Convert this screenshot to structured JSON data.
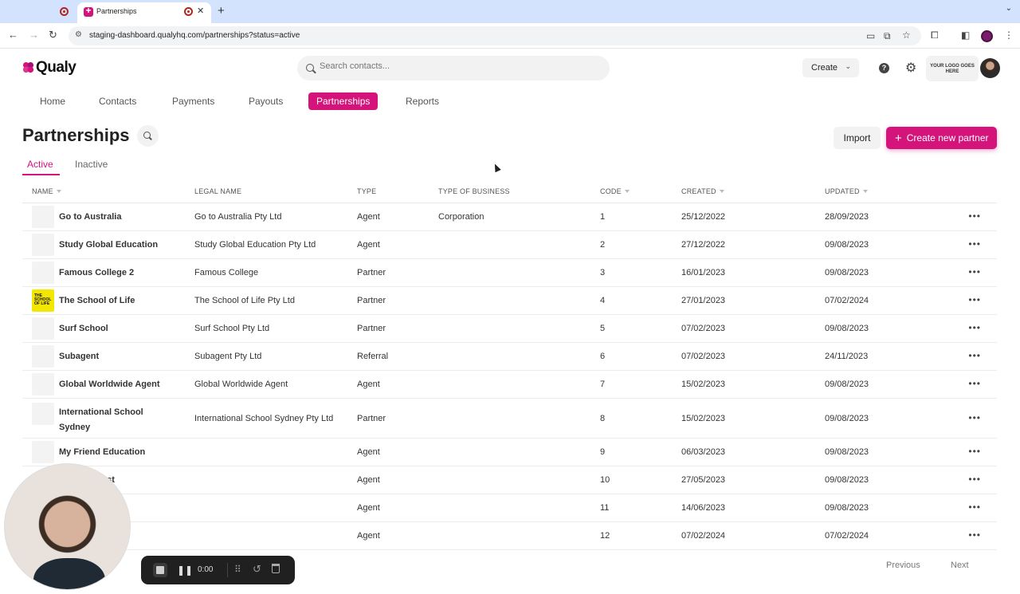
{
  "browser": {
    "tab_title": "Partnerships",
    "url": "staging-dashboard.qualyhq.com/partnerships?status=active"
  },
  "header": {
    "logo_text": "Qualy",
    "search_placeholder": "Search contacts...",
    "create_label": "Create",
    "logo_slot_text": "YOUR LOGO GOES HERE"
  },
  "nav": {
    "items": [
      "Home",
      "Contacts",
      "Payments",
      "Payouts",
      "Partnerships",
      "Reports"
    ],
    "active": "Partnerships"
  },
  "page": {
    "title": "Partnerships",
    "import_label": "Import",
    "create_partner_label": "Create new partner",
    "tabs": [
      "Active",
      "Inactive"
    ]
  },
  "table": {
    "columns": [
      "NAME",
      "LEGAL NAME",
      "TYPE",
      "TYPE OF BUSINESS",
      "CODE",
      "CREATED",
      "UPDATED"
    ],
    "rows": [
      {
        "name": "Go to Australia",
        "legal": "Go to Australia Pty Ltd",
        "type": "Agent",
        "business": "Corporation",
        "code": "1",
        "created": "25/12/2022",
        "updated": "28/09/2023"
      },
      {
        "name": "Study Global Education",
        "legal": "Study Global Education Pty Ltd",
        "type": "Agent",
        "business": "",
        "code": "2",
        "created": "27/12/2022",
        "updated": "09/08/2023"
      },
      {
        "name": "Famous College 2",
        "legal": "Famous College",
        "type": "Partner",
        "business": "",
        "code": "3",
        "created": "16/01/2023",
        "updated": "09/08/2023"
      },
      {
        "name": "The School of Life",
        "legal": "The School of Life Pty Ltd",
        "type": "Partner",
        "business": "",
        "code": "4",
        "created": "27/01/2023",
        "updated": "07/02/2024"
      },
      {
        "name": "Surf School",
        "legal": "Surf School Pty Ltd",
        "type": "Partner",
        "business": "",
        "code": "5",
        "created": "07/02/2023",
        "updated": "09/08/2023"
      },
      {
        "name": "Subagent",
        "legal": "Subagent Pty Ltd",
        "type": "Referral",
        "business": "",
        "code": "6",
        "created": "07/02/2023",
        "updated": "24/11/2023"
      },
      {
        "name": "Global Worldwide Agent",
        "legal": "Global Worldwide Agent",
        "type": "Agent",
        "business": "",
        "code": "7",
        "created": "15/02/2023",
        "updated": "09/08/2023"
      },
      {
        "name_line1": "International School",
        "name_line2": "Sydney",
        "legal": "International School Sydney Pty Ltd",
        "type": "Partner",
        "business": "",
        "code": "8",
        "created": "15/02/2023",
        "updated": "09/08/2023"
      },
      {
        "name": "My Friend Education",
        "legal": "",
        "type": "Agent",
        "business": "",
        "code": "9",
        "created": "06/03/2023",
        "updated": "09/08/2023"
      },
      {
        "name": "est",
        "legal": "",
        "type": "Agent",
        "business": "",
        "code": "10",
        "created": "27/05/2023",
        "updated": "09/08/2023"
      },
      {
        "name": "",
        "legal": "",
        "type": "Agent",
        "business": "",
        "code": "11",
        "created": "14/06/2023",
        "updated": "09/08/2023"
      },
      {
        "name": "",
        "legal": "",
        "type": "Agent",
        "business": "",
        "code": "12",
        "created": "07/02/2024",
        "updated": "07/02/2024"
      }
    ]
  },
  "pager": {
    "previous": "Previous",
    "next": "Next"
  },
  "recorder": {
    "time": "0:00"
  },
  "colors": {
    "brand": "#d4147a"
  }
}
